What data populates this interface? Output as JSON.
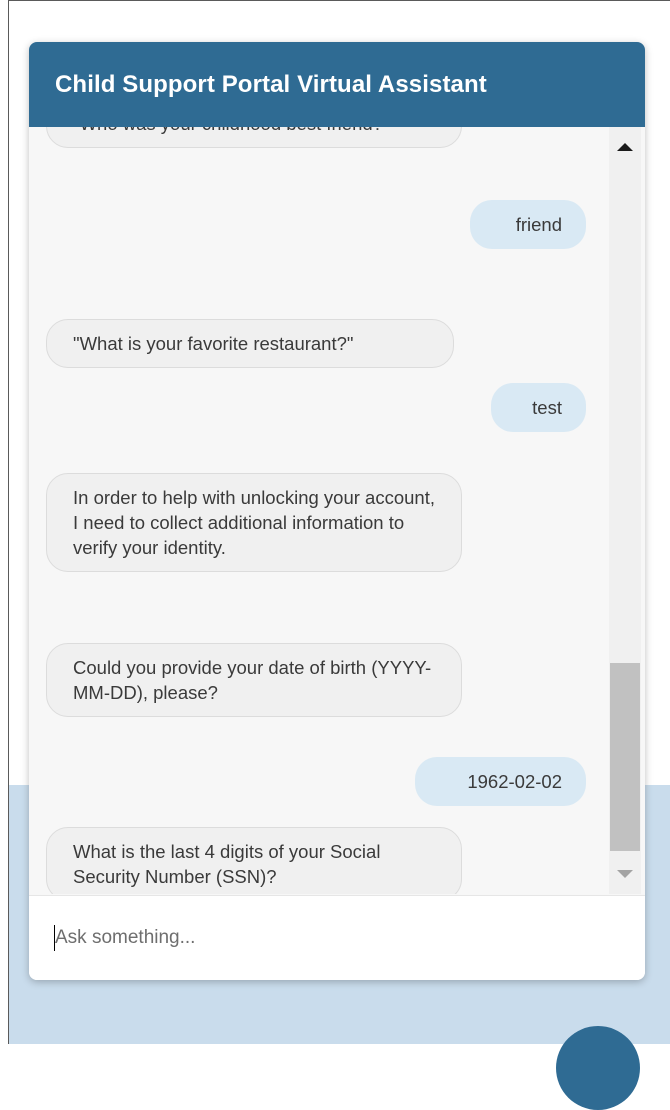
{
  "header": {
    "title": "Child Support Portal Virtual Assistant"
  },
  "messages": [
    {
      "sender": "bot",
      "text": "\"Who was your childhood best friend?\""
    },
    {
      "sender": "user",
      "text": "friend"
    },
    {
      "sender": "bot",
      "text": "\"What is your favorite restaurant?\""
    },
    {
      "sender": "user",
      "text": "test"
    },
    {
      "sender": "bot",
      "text": "In order to help with unlocking your account, I need to collect additional information to verify your identity."
    },
    {
      "sender": "bot",
      "text": "Could you provide your date of birth (YYYY-MM-DD), please?"
    },
    {
      "sender": "user",
      "text": "1962-02-02"
    },
    {
      "sender": "bot",
      "text": "What is the last 4 digits of your Social Security Number (SSN)?"
    }
  ],
  "input": {
    "placeholder": "Ask something...",
    "value": ""
  },
  "colors": {
    "header_bg": "#2f6b93",
    "user_bubble": "#d9e9f4",
    "bot_bubble": "#f0f0f0",
    "page_band": "#c9dcec"
  }
}
